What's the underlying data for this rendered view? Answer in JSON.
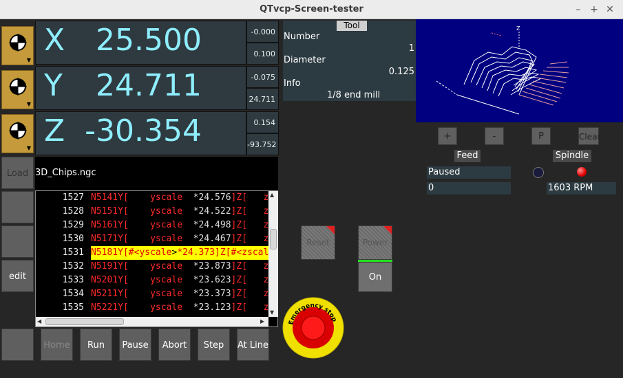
{
  "window": {
    "title": "QTvcp-Screen-tester",
    "min": "–",
    "max": "+",
    "close": "✕"
  },
  "dro": {
    "x": {
      "axis": "X",
      "value": "25.500",
      "a": "-0.000",
      "b": "0.100"
    },
    "y": {
      "axis": "Y",
      "value": "24.711",
      "a": "-0.075",
      "b": "24.711"
    },
    "z": {
      "axis": "Z",
      "value": "-30.354",
      "a": "0.154",
      "b": "-93.752"
    }
  },
  "tool": {
    "title": "Tool",
    "number_label": "Number",
    "number": "1",
    "diameter_label": "Diameter",
    "diameter": "0.125",
    "info_label": "Info",
    "info": "1/8 end mill"
  },
  "preview_buttons": {
    "plus": "+",
    "minus": "-",
    "p": "P",
    "clear": "Clear"
  },
  "feed": {
    "label": "Feed",
    "status": "Paused",
    "value": "0"
  },
  "spindle": {
    "label": "Spindle",
    "rpm": "1603 RPM"
  },
  "side": {
    "load": "Load",
    "edit": "edit"
  },
  "file": {
    "name": "3D_Chips.ngc"
  },
  "gcode": [
    {
      "n": "1527",
      "t": "N5141",
      "v": "*24.576"
    },
    {
      "n": "1528",
      "t": "N5151",
      "v": "*24.522"
    },
    {
      "n": "1529",
      "t": "N5161",
      "v": "*24.498"
    },
    {
      "n": "1530",
      "t": "N5171",
      "v": "*24.467"
    },
    {
      "n": "1531",
      "t": "N5181",
      "v": "*24.373",
      "hl": true
    },
    {
      "n": "1532",
      "t": "N5191",
      "v": "*23.873"
    },
    {
      "n": "1533",
      "t": "N5201",
      "v": "*23.623"
    },
    {
      "n": "1534",
      "t": "N5211",
      "v": "*23.373"
    },
    {
      "n": "1535",
      "t": "N5221",
      "v": "*23.123"
    }
  ],
  "gcode_tokens": {
    "y": "Y[",
    "yscale": "yscale",
    "z": "]Z[",
    "zscale": "zscale",
    "tail": "*",
    "hl_y": "Y[#<",
    "hl_yscale": "yscale",
    "hl_mid": ">",
    "hl_z": "]Z[#<",
    "hl_zscale": "zscale",
    "hl_end": ">*"
  },
  "machine": {
    "estop_label": "Reset",
    "power_label": "Power",
    "on": "On",
    "estop_text": "Emergency stop"
  },
  "bottom": {
    "home": "Home",
    "run": "Run",
    "pause": "Pause",
    "abort": "Abort",
    "step": "Step",
    "at_line": "At Line"
  },
  "colors": {
    "dro_text": "#8feeff",
    "gcode_red": "#ff2a2a",
    "highlight": "#ffff00",
    "estop_yellow": "#f0e000",
    "estop_red": "#e00000"
  }
}
